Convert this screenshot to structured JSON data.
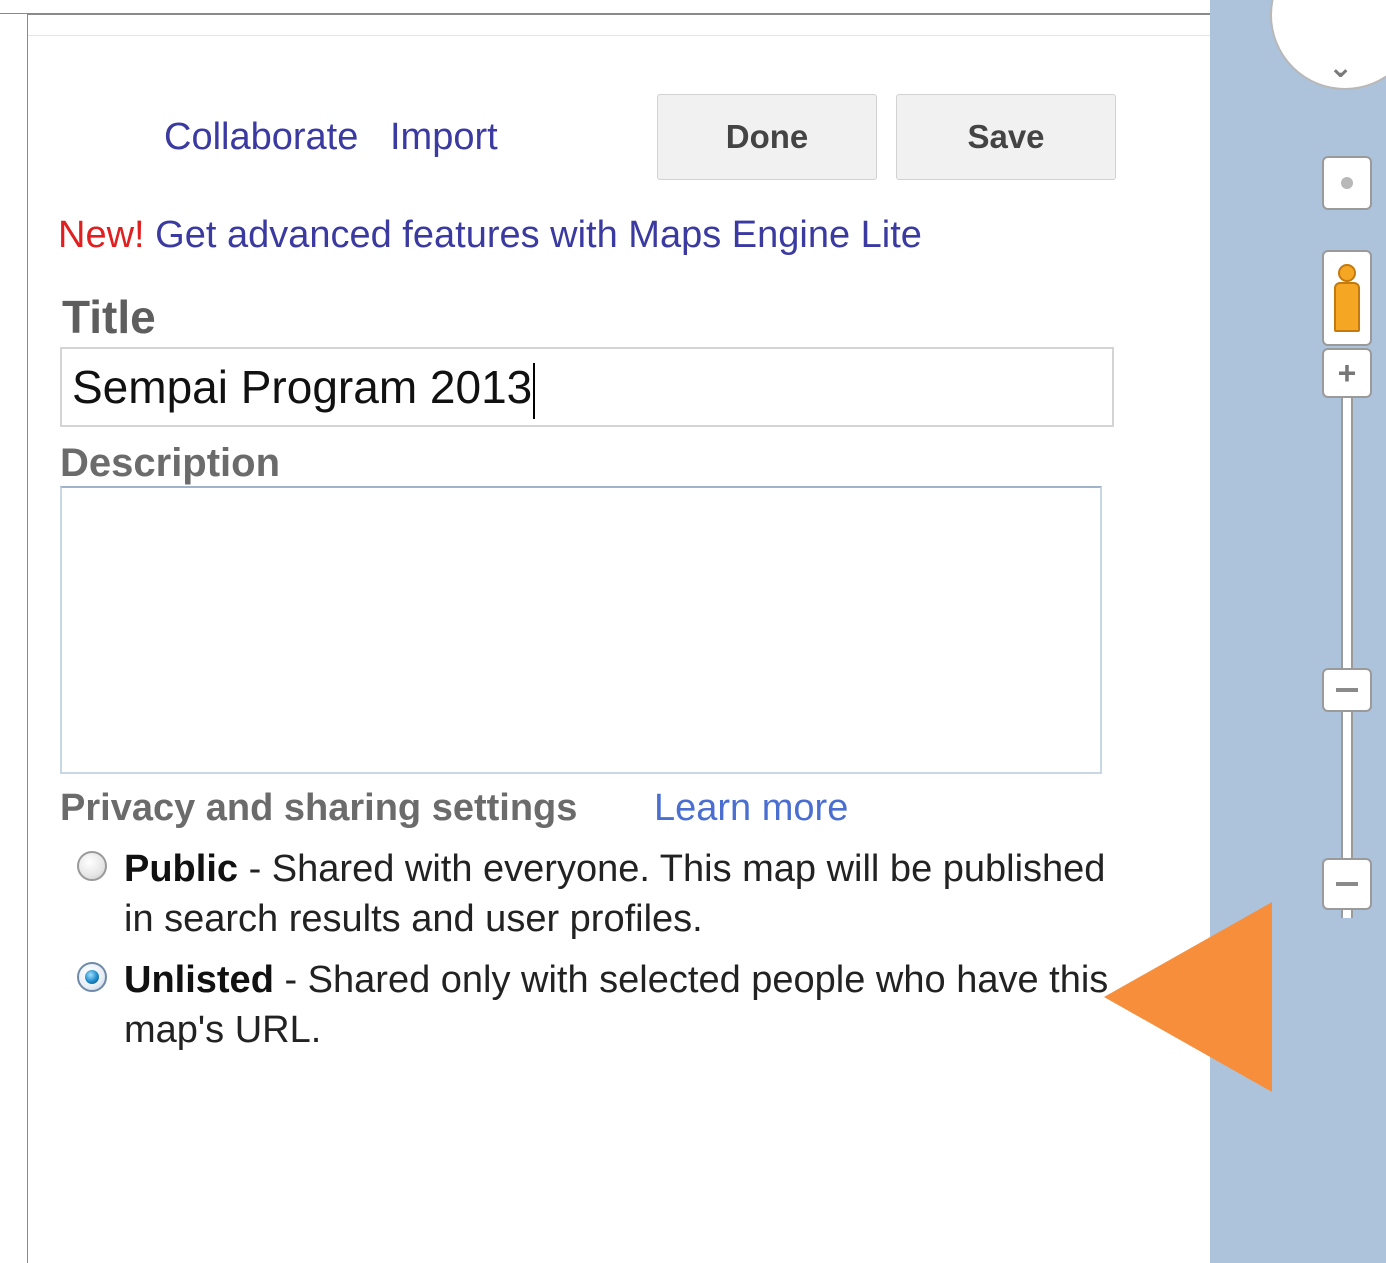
{
  "toolbar": {
    "collaborate_label": "Collaborate",
    "import_label": "Import",
    "done_label": "Done",
    "save_label": "Save"
  },
  "promo": {
    "new_label": "New!",
    "text": "Get advanced features with Maps Engine Lite"
  },
  "form": {
    "title_label": "Title",
    "title_value": "Sempai Program 2013",
    "description_label": "Description",
    "description_value": ""
  },
  "privacy": {
    "label": "Privacy and sharing settings",
    "learn_more_label": "Learn more",
    "options": [
      {
        "name": "Public",
        "description": " - Shared with everyone. This map will be published in search results and user profiles.",
        "selected": false
      },
      {
        "name": "Unlisted",
        "description": " - Shared only with selected people who have this map's URL.",
        "selected": true
      }
    ]
  },
  "map_controls": {
    "zoom_in_symbol": "+",
    "pegman_icon": "pegman-icon",
    "compass_icon": "compass-icon"
  },
  "colors": {
    "link": "#3a3aa0",
    "new_badge": "#e02020",
    "map_background": "#adc3dc",
    "annotation_arrow": "#f68e3c"
  }
}
